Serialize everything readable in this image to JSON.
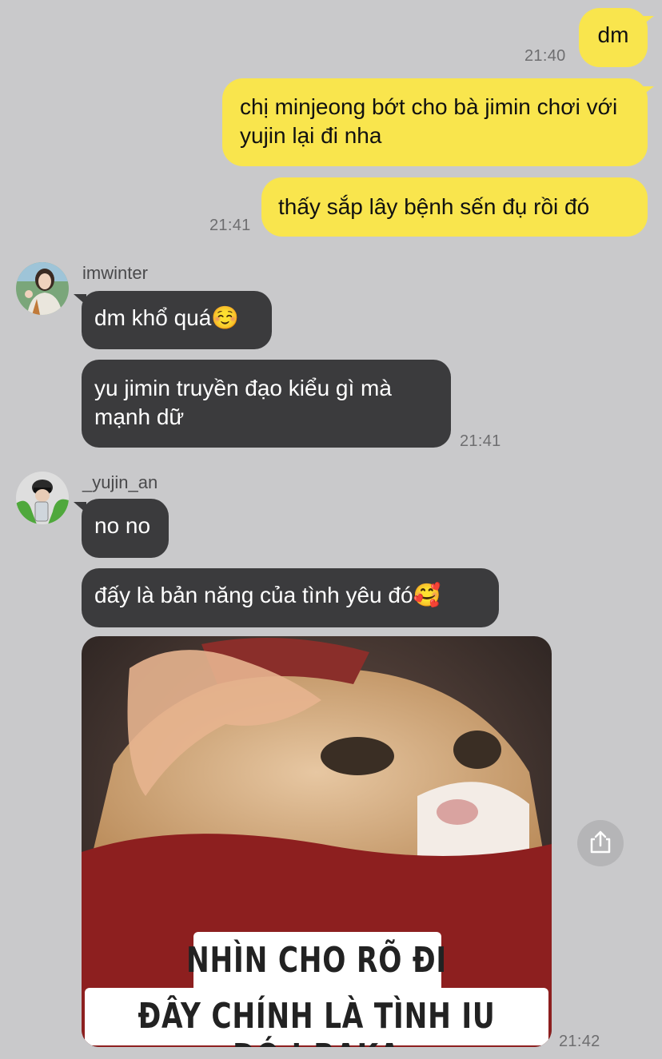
{
  "colors": {
    "background": "#c9c9cb",
    "outgoing_bubble": "#f9e54d",
    "incoming_bubble": "#3b3b3d",
    "timestamp": "#6e6e70"
  },
  "messages_out": [
    {
      "text": "dm",
      "time": "21:40"
    },
    {
      "text": "chị minjeong bớt cho bà jimin chơi với yujin lại đi nha"
    },
    {
      "text": "thấy sắp lây bệnh sến đụ rồi đó",
      "time": "21:41"
    }
  ],
  "group_winter": {
    "sender": "imwinter",
    "messages": [
      {
        "text": "dm khổ quá☺️"
      },
      {
        "text": "yu jimin truyền đạo kiểu gì mà mạnh dữ",
        "time": "21:41"
      }
    ]
  },
  "group_yujin": {
    "sender": "_yujin_an",
    "messages": [
      {
        "text": "no no"
      },
      {
        "text": "đấy là bản năng của tình yêu đó🥰"
      }
    ],
    "image": {
      "caption_line1": "NHÌN CHO RÕ ĐI",
      "caption_line2": "ĐÂY CHÍNH LÀ TÌNH IU ĐÓ ! BAKA",
      "time": "21:42",
      "share_icon": "share-icon"
    }
  }
}
